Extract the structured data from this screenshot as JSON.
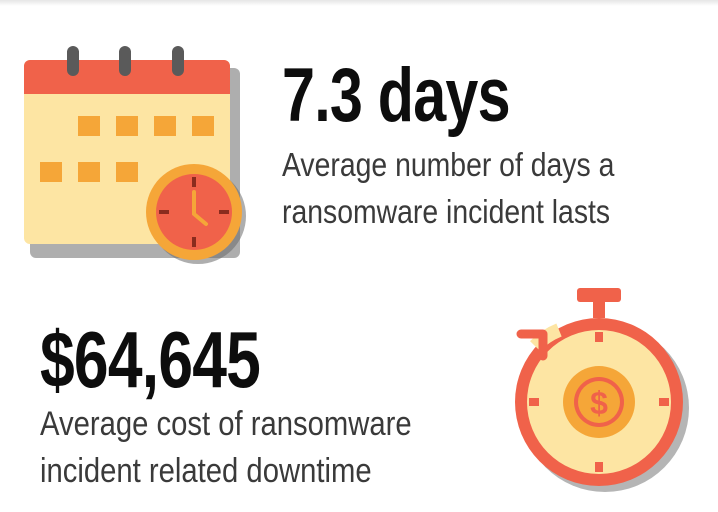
{
  "stats": [
    {
      "value": "7.3 days",
      "description_line1": "Average number of days a",
      "description_line2": "ransomware incident lasts",
      "icon": "calendar-clock-icon"
    },
    {
      "value": "$64,645",
      "description_line1": "Average cost of ransomware",
      "description_line2": "incident related downtime",
      "icon": "stopwatch-dollar-icon"
    }
  ],
  "colors": {
    "accent_red": "#f0624a",
    "accent_orange": "#f5a638",
    "cream": "#fde5a3",
    "text_dark": "#0d0d0d",
    "text_gray": "#3a3a3a"
  }
}
